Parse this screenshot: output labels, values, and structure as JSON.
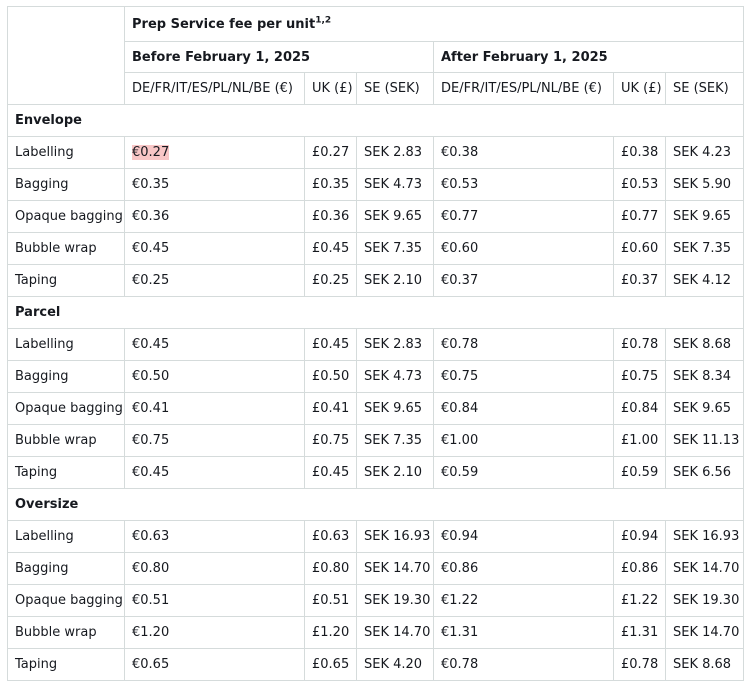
{
  "header": {
    "title": "Prep Service fee per unit",
    "title_sup": "1,2",
    "before_label": "Before February 1, 2025",
    "after_label": "After February 1, 2025",
    "columns": [
      "DE/FR/IT/ES/PL/NL/BE (€)",
      "UK (£)",
      "SE (SEK)",
      "DE/FR/IT/ES/PL/NL/BE (€)",
      "UK (£)",
      "SE (SEK)"
    ]
  },
  "sections": [
    {
      "name": "Envelope",
      "rows": [
        {
          "service": "Labelling",
          "values": [
            "€0.27",
            "£0.27",
            "SEK 2.83",
            "€0.38",
            "£0.38",
            "SEK 4.23"
          ]
        },
        {
          "service": "Bagging",
          "values": [
            "€0.35",
            "£0.35",
            "SEK 4.73",
            "€0.53",
            "£0.53",
            "SEK 5.90"
          ]
        },
        {
          "service": "Opaque bagging",
          "values": [
            "€0.36",
            "£0.36",
            "SEK 9.65",
            "€0.77",
            "£0.77",
            "SEK 9.65"
          ]
        },
        {
          "service": "Bubble wrap",
          "values": [
            "€0.45",
            "£0.45",
            "SEK 7.35",
            "€0.60",
            "£0.60",
            "SEK 7.35"
          ]
        },
        {
          "service": "Taping",
          "values": [
            "€0.25",
            "£0.25",
            "SEK 2.10",
            "€0.37",
            "£0.37",
            "SEK 4.12"
          ]
        }
      ]
    },
    {
      "name": "Parcel",
      "rows": [
        {
          "service": "Labelling",
          "values": [
            "€0.45",
            "£0.45",
            "SEK 2.83",
            "€0.78",
            "£0.78",
            "SEK 8.68"
          ]
        },
        {
          "service": "Bagging",
          "values": [
            "€0.50",
            "£0.50",
            "SEK 4.73",
            "€0.75",
            "£0.75",
            "SEK 8.34"
          ]
        },
        {
          "service": "Opaque bagging",
          "values": [
            "€0.41",
            "£0.41",
            "SEK 9.65",
            "€0.84",
            "£0.84",
            "SEK 9.65"
          ]
        },
        {
          "service": "Bubble wrap",
          "values": [
            "€0.75",
            "£0.75",
            "SEK 7.35",
            "€1.00",
            "£1.00",
            "SEK 11.13"
          ]
        },
        {
          "service": "Taping",
          "values": [
            "€0.45",
            "£0.45",
            "SEK 2.10",
            "€0.59",
            "£0.59",
            "SEK 6.56"
          ]
        }
      ]
    },
    {
      "name": "Oversize",
      "rows": [
        {
          "service": "Labelling",
          "values": [
            "€0.63",
            "£0.63",
            "SEK 16.93",
            "€0.94",
            "£0.94",
            "SEK 16.93"
          ]
        },
        {
          "service": "Bagging",
          "values": [
            "€0.80",
            "£0.80",
            "SEK 14.70",
            "€0.86",
            "£0.86",
            "SEK 14.70"
          ]
        },
        {
          "service": "Opaque bagging",
          "values": [
            "€0.51",
            "£0.51",
            "SEK 19.30",
            "€1.22",
            "£1.22",
            "SEK 19.30"
          ]
        },
        {
          "service": "Bubble wrap",
          "values": [
            "€1.20",
            "£1.20",
            "SEK 14.70",
            "€1.31",
            "£1.31",
            "SEK 14.70"
          ]
        },
        {
          "service": "Taping",
          "values": [
            "€0.65",
            "£0.65",
            "SEK 4.20",
            "€0.78",
            "£0.78",
            "SEK 8.68"
          ]
        }
      ]
    }
  ],
  "highlight_color": "#f8c6c6"
}
